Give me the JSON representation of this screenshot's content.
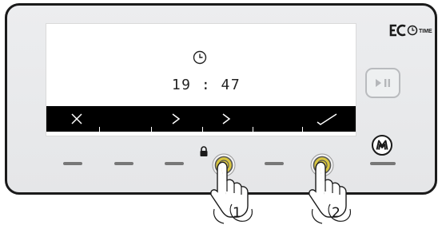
{
  "display": {
    "time": "19 : 47",
    "softkeys": [
      {
        "icon": "close-icon"
      },
      {
        "icon": "chevron-right-icon"
      },
      {
        "icon": "chevron-right-icon"
      },
      {
        "icon": "checkmark-icon"
      }
    ]
  },
  "brand": {
    "logo_text": "ECO TIME"
  },
  "controls": {
    "play_pause_icon": "play-pause-icon",
    "menu_icon": "m-icon",
    "lock_icon": "lock-icon"
  },
  "steps": [
    {
      "label": "1"
    },
    {
      "label": "2"
    }
  ],
  "colors": {
    "panel": "#e8e9eb",
    "outline": "#1a1a1a",
    "display_bar": "#000000",
    "key_press": "#d9c640"
  }
}
